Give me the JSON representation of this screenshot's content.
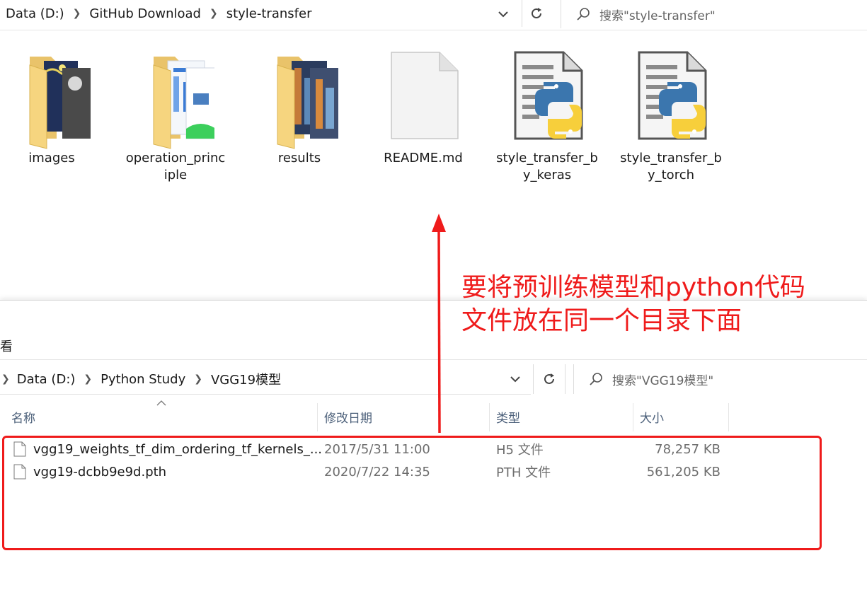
{
  "top_window": {
    "breadcrumbs": [
      "Data (D:)",
      "GitHub Download",
      "style-transfer"
    ],
    "search_placeholder": "搜索\"style-transfer\"",
    "items": [
      {
        "label": "images",
        "type": "folder"
      },
      {
        "label": "operation_princ iple",
        "type": "folder"
      },
      {
        "label": "results",
        "type": "folder"
      },
      {
        "label": "README.md",
        "type": "file"
      },
      {
        "label": "style_transfer_b y_keras",
        "type": "python"
      },
      {
        "label": "style_transfer_b y_torch",
        "type": "python"
      }
    ]
  },
  "annotation": {
    "line1": "要将预训练模型和python代码",
    "line2": "文件放在同一个目录下面",
    "color": "#ef1b1b"
  },
  "bottom_window": {
    "ribbon_fragment": "看",
    "breadcrumbs": [
      "Data (D:)",
      "Python Study",
      "VGG19模型"
    ],
    "search_placeholder": "搜索\"VGG19模型\"",
    "columns": [
      "名称",
      "修改日期",
      "类型",
      "大小"
    ],
    "files": [
      {
        "name": "vgg19_weights_tf_dim_ordering_tf_kernels_...",
        "modified": "2017/5/31 11:00",
        "type": "H5 文件",
        "size": "78,257 KB"
      },
      {
        "name": "vgg19-dcbb9e9d.pth",
        "modified": "2020/7/22 14:35",
        "type": "PTH 文件",
        "size": "561,205 KB"
      }
    ]
  }
}
